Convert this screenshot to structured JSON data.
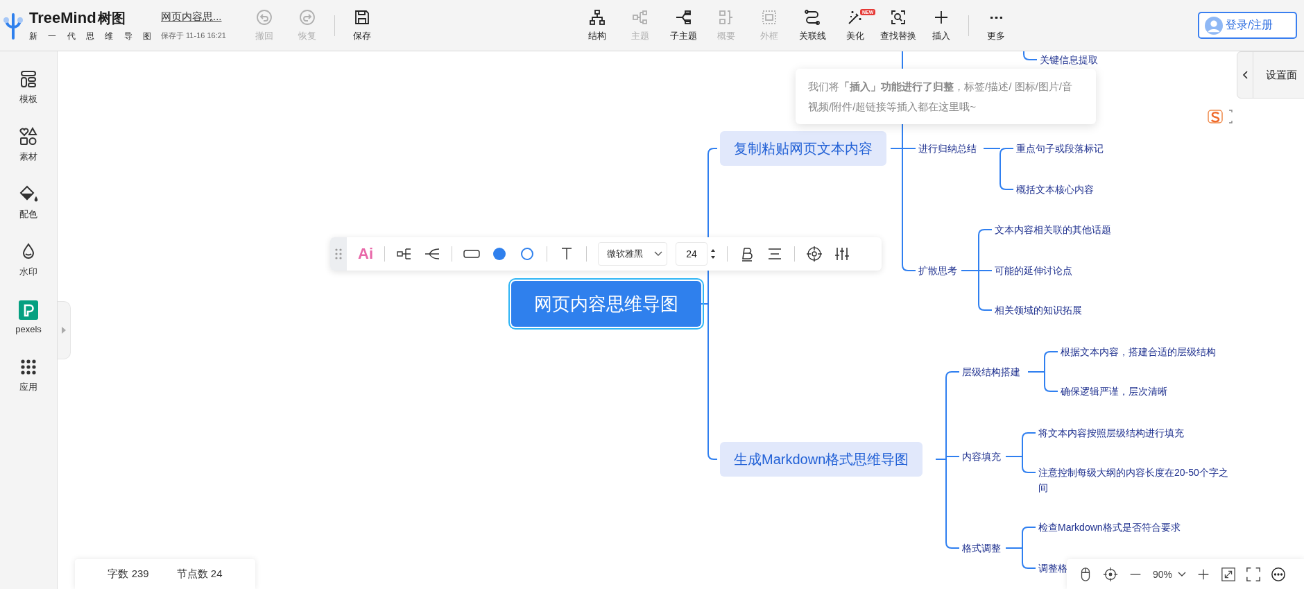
{
  "header": {
    "logo": {
      "name": "TreeMind",
      "name_cn": "树图",
      "tagline": "新 一 代 思 维 导 图"
    },
    "document": {
      "title": "网页内容思...",
      "saved": "保存于 11-16 16:21"
    },
    "history": [
      {
        "label": "撤回",
        "kind": "undo",
        "disabled": true
      },
      {
        "label": "恢复",
        "kind": "redo",
        "disabled": true
      },
      {
        "label": "保存",
        "kind": "save",
        "disabled": false
      }
    ],
    "tools": [
      {
        "label": "结构",
        "kind": "structure",
        "disabled": false
      },
      {
        "label": "主题",
        "kind": "topic",
        "disabled": true
      },
      {
        "label": "子主题",
        "kind": "subtopic",
        "disabled": false
      },
      {
        "label": "概要",
        "kind": "summary",
        "disabled": true
      },
      {
        "label": "外框",
        "kind": "boundary",
        "disabled": true
      },
      {
        "label": "关联线",
        "kind": "relation",
        "disabled": false
      },
      {
        "label": "美化",
        "kind": "beautify",
        "disabled": false,
        "badge": "NEW"
      },
      {
        "label": "查找替换",
        "kind": "find",
        "disabled": false
      },
      {
        "label": "插入",
        "kind": "insert",
        "disabled": false
      },
      {
        "label": "更多",
        "kind": "more",
        "disabled": false
      }
    ],
    "login": "登录/注册"
  },
  "sidebar": [
    {
      "label": "模板",
      "kind": "template"
    },
    {
      "label": "素材",
      "kind": "material"
    },
    {
      "label": "配色",
      "kind": "color"
    },
    {
      "label": "水印",
      "kind": "watermark"
    },
    {
      "label": "pexels",
      "kind": "pexels"
    },
    {
      "label": "应用",
      "kind": "apps"
    }
  ],
  "tooltip": "我们将**「插入」功能进行了归整**，标签/描述/ 图标/图片/音视频/附件/超链接等插入都在这里哦~",
  "settings_panel": {
    "label": "设置面"
  },
  "format_toolbar": {
    "ai": "Ai",
    "font": "微软雅黑",
    "size": "24"
  },
  "mindmap": {
    "root": {
      "text": "网页内容思维导图",
      "selected": true,
      "children": [
        {
          "text": "复制粘贴网页文本内容",
          "children": [
            {
              "children": [
                {
                  "text": "关键信息提取"
                }
              ]
            },
            {
              "text": "进行归纳总结",
              "children": [
                {
                  "text": "重点句子或段落标记"
                },
                {
                  "text": "概括文本核心内容"
                }
              ]
            },
            {
              "text": "扩散思考",
              "children": [
                {
                  "text": "文本内容相关联的其他话题"
                },
                {
                  "text": "可能的延伸讨论点"
                },
                {
                  "text": "相关领域的知识拓展"
                }
              ]
            }
          ]
        },
        {
          "text": "生成Markdown格式思维导图",
          "children": [
            {
              "text": "层级结构搭建",
              "children": [
                {
                  "text": "根据文本内容，搭建合适的层级结构"
                },
                {
                  "text": "确保逻辑严谨，层次清晰"
                }
              ]
            },
            {
              "text": "内容填充",
              "children": [
                {
                  "text": "将文本内容按照层级结构进行填充"
                },
                {
                  "text": "注意控制每级大纲的内容长度在20-50个字之间"
                }
              ]
            },
            {
              "text": "格式调整",
              "children": [
                {
                  "text": "检查Markdown格式是否符合要求"
                },
                {
                  "text": "调整格"
                }
              ]
            }
          ]
        }
      ]
    }
  },
  "status": {
    "words": "字数 239",
    "nodes": "节点数 24"
  },
  "zoom": {
    "level": "90%"
  }
}
